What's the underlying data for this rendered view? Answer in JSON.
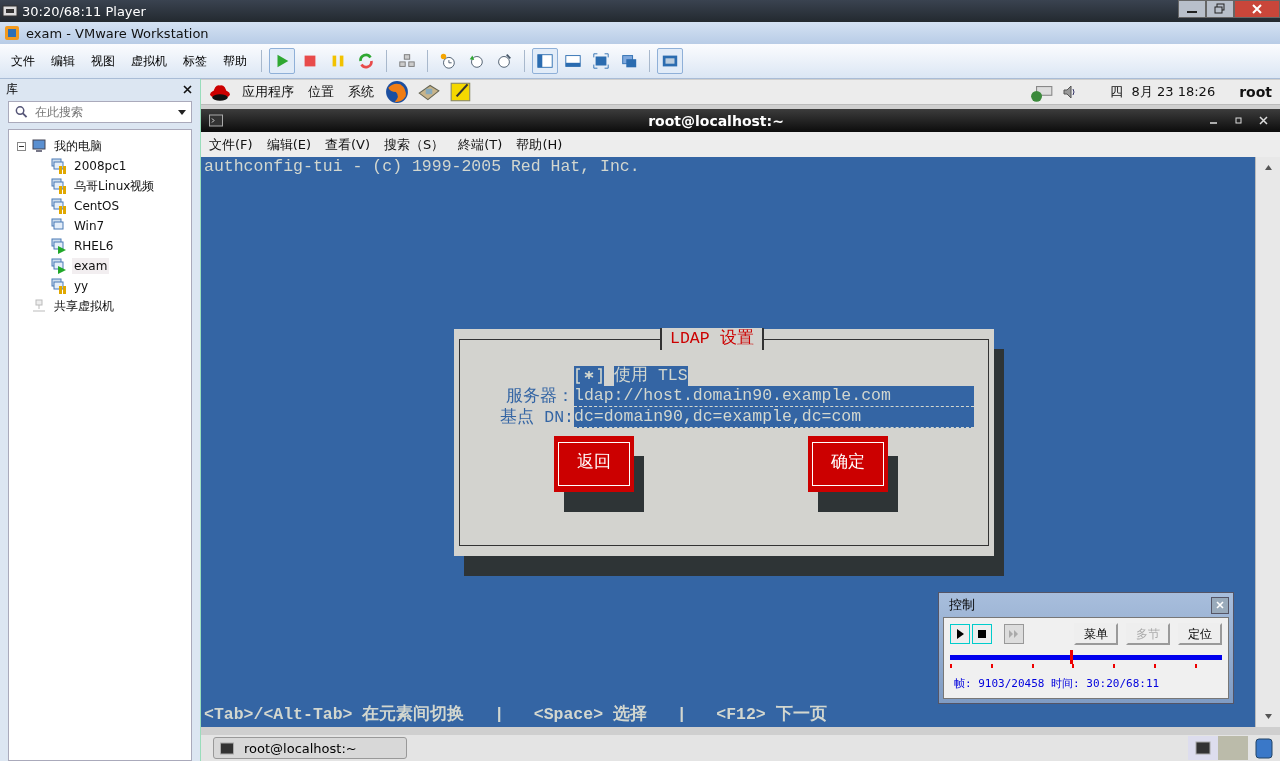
{
  "player_bar": {
    "title": "30:20/68:11 Player"
  },
  "window": {
    "title": "exam - VMware Workstation"
  },
  "menu": [
    "文件",
    "编辑",
    "视图",
    "虚拟机",
    "标签",
    "帮助"
  ],
  "library": {
    "title": "库",
    "search": {
      "placeholder": "在此搜索"
    },
    "tree": [
      {
        "label": "我的电脑",
        "kind": "computer",
        "expanded": true,
        "selected": false,
        "children": [
          {
            "label": "2008pc1",
            "kind": "vm-paused",
            "selected": false
          },
          {
            "label": "乌哥Linux视频",
            "kind": "vm-paused",
            "selected": false
          },
          {
            "label": "CentOS",
            "kind": "vm-paused",
            "selected": false
          },
          {
            "label": "Win7",
            "kind": "vm-off",
            "selected": false
          },
          {
            "label": "RHEL6",
            "kind": "vm-running",
            "selected": false
          },
          {
            "label": "exam",
            "kind": "vm-running",
            "selected": true
          },
          {
            "label": "yy",
            "kind": "vm-paused",
            "selected": false
          }
        ]
      },
      {
        "label": "共享虚拟机",
        "kind": "shared",
        "selected": false
      }
    ]
  },
  "guest_panel": {
    "menus": [
      "应用程序",
      "位置",
      "系统"
    ],
    "clock": "四  8月 23 18:26",
    "user": "root"
  },
  "terminal": {
    "title": "root@localhost:~",
    "menu": [
      "文件(F)",
      "编辑(E)",
      "查看(V)",
      "搜索（S）",
      "終端(T)",
      "帮助(H)"
    ],
    "header": "authconfig-tui - (c) 1999-2005 Red Hat, Inc.",
    "dialog": {
      "title": "LDAP 设置",
      "tls": {
        "checked": true,
        "label": "使用 TLS"
      },
      "fields": [
        {
          "label": "服务器：",
          "value": "ldap://host.domain90.example.com"
        },
        {
          "label": "基点 DN:",
          "value": "dc=domain90,dc=example,dc=com"
        }
      ],
      "buttons": [
        "返回",
        "确定"
      ]
    },
    "help": "<Tab>/<Alt-Tab> 在元素间切换   |   <Space> 选择   |   <F12> 下一页"
  },
  "taskbar": {
    "items": [
      {
        "label": "root@localhost:~",
        "selected": false
      }
    ]
  },
  "control": {
    "title": "控制",
    "buttons": [
      {
        "label": "菜单",
        "disabled": false
      },
      {
        "label": "多节",
        "disabled": true
      },
      {
        "label": "定位",
        "disabled": false
      }
    ],
    "level": 0.44,
    "status": "帧: 9103/20458 时间: 30:20/68:11"
  }
}
